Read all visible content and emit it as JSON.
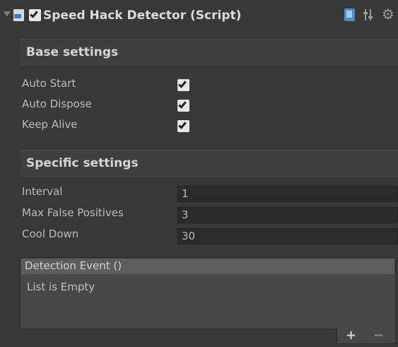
{
  "component": {
    "title": "Speed Hack Detector (Script)",
    "enabled": true
  },
  "base_settings": {
    "header": "Base settings",
    "items": [
      {
        "label": "Auto Start",
        "checked": true
      },
      {
        "label": "Auto Dispose",
        "checked": true
      },
      {
        "label": "Keep Alive",
        "checked": true
      }
    ]
  },
  "specific_settings": {
    "header": "Specific settings",
    "fields": [
      {
        "label": "Interval",
        "value": "1"
      },
      {
        "label": "Max False Positives",
        "value": "3"
      },
      {
        "label": "Cool Down",
        "value": "30"
      }
    ]
  },
  "detection_event": {
    "header": "Detection Event ()",
    "empty_text": "List is Empty",
    "add_label": "+",
    "remove_label": "−"
  },
  "icons": {
    "foldout": "foldout-arrow-icon",
    "script": "cs-script-icon",
    "help": "help-book-icon",
    "preset": "preset-sliders-icon",
    "settings": "gear-icon"
  }
}
